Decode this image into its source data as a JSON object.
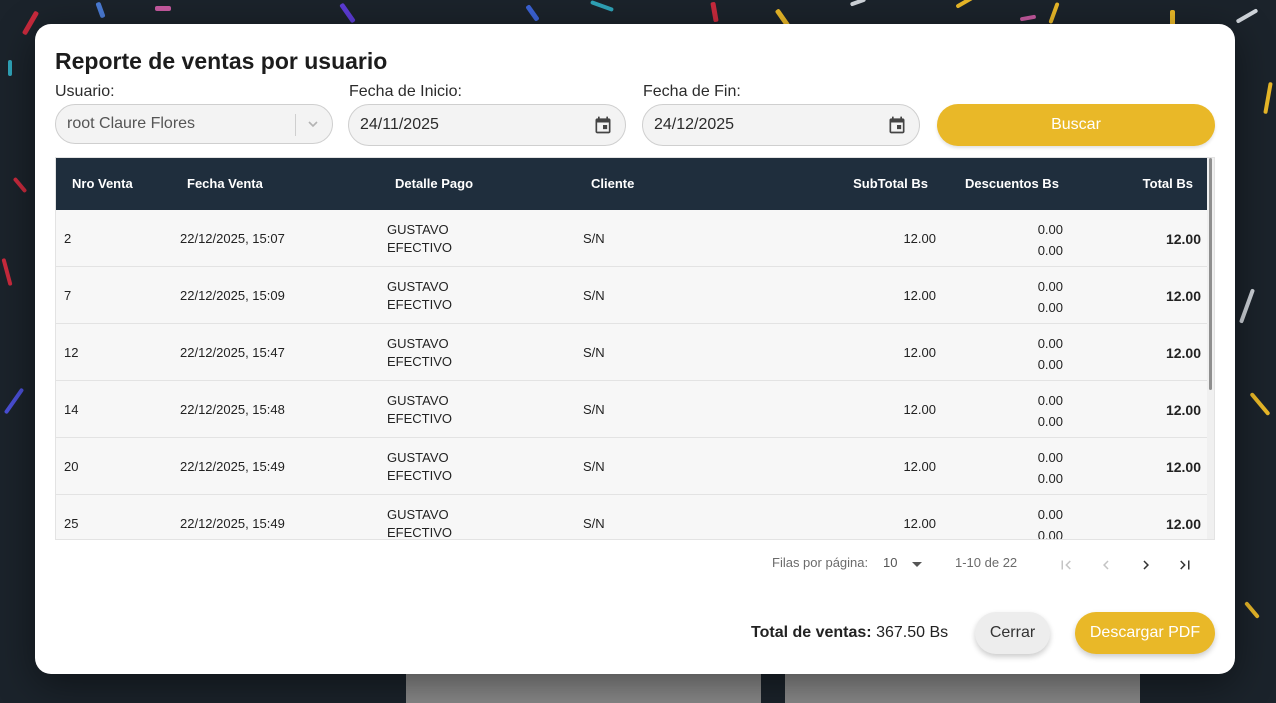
{
  "modal": {
    "title": "Reporte de ventas por usuario"
  },
  "filters": {
    "usuario_label": "Usuario:",
    "usuario_value": "root Claure Flores",
    "fecha_inicio_label": "Fecha de Inicio:",
    "fecha_inicio_value": "24/11/2025",
    "fecha_fin_label": "Fecha de Fin:",
    "fecha_fin_value": "24/12/2025",
    "buscar_label": "Buscar"
  },
  "table": {
    "headers": {
      "nro": "Nro Venta",
      "fecha": "Fecha Venta",
      "detalle": "Detalle Pago",
      "cliente": "Cliente",
      "subtotal": "SubTotal Bs",
      "descuentos": "Descuentos Bs",
      "total": "Total Bs"
    },
    "rows": [
      {
        "nro": "2",
        "fecha": "22/12/2025, 15:07",
        "detalle_a": "GUSTAVO",
        "detalle_b": "EFECTIVO",
        "cliente": "S/N",
        "subtotal": "12.00",
        "desc_a": "0.00",
        "desc_b": "0.00",
        "total": "12.00"
      },
      {
        "nro": "7",
        "fecha": "22/12/2025, 15:09",
        "detalle_a": "GUSTAVO",
        "detalle_b": "EFECTIVO",
        "cliente": "S/N",
        "subtotal": "12.00",
        "desc_a": "0.00",
        "desc_b": "0.00",
        "total": "12.00"
      },
      {
        "nro": "12",
        "fecha": "22/12/2025, 15:47",
        "detalle_a": "GUSTAVO",
        "detalle_b": "EFECTIVO",
        "cliente": "S/N",
        "subtotal": "12.00",
        "desc_a": "0.00",
        "desc_b": "0.00",
        "total": "12.00"
      },
      {
        "nro": "14",
        "fecha": "22/12/2025, 15:48",
        "detalle_a": "GUSTAVO",
        "detalle_b": "EFECTIVO",
        "cliente": "S/N",
        "subtotal": "12.00",
        "desc_a": "0.00",
        "desc_b": "0.00",
        "total": "12.00"
      },
      {
        "nro": "20",
        "fecha": "22/12/2025, 15:49",
        "detalle_a": "GUSTAVO",
        "detalle_b": "EFECTIVO",
        "cliente": "S/N",
        "subtotal": "12.00",
        "desc_a": "0.00",
        "desc_b": "0.00",
        "total": "12.00"
      },
      {
        "nro": "25",
        "fecha": "22/12/2025, 15:49",
        "detalle_a": "GUSTAVO",
        "detalle_b": "EFECTIVO",
        "cliente": "S/N",
        "subtotal": "12.00",
        "desc_a": "0.00",
        "desc_b": "0.00",
        "total": "12.00"
      }
    ]
  },
  "pagination": {
    "rows_per_page_label": "Filas por página:",
    "rows_per_page_value": "10",
    "range": "1-10 de 22"
  },
  "footer": {
    "total_label": "Total de ventas:",
    "total_value": "367.50 Bs",
    "cerrar_label": "Cerrar",
    "pdf_label": "Descargar PDF"
  },
  "colors": {
    "accent": "#e9b828",
    "table_header": "#1f2e3d",
    "backdrop": "#1b232b"
  },
  "icons": {
    "usuario_dropdown": "chevron-down-icon",
    "fecha_inicio": "calendar-icon",
    "fecha_fin": "calendar-icon",
    "pager_first": "first-page-icon",
    "pager_prev": "chevron-left-icon",
    "pager_next": "chevron-right-icon",
    "pager_last": "last-page-icon"
  }
}
